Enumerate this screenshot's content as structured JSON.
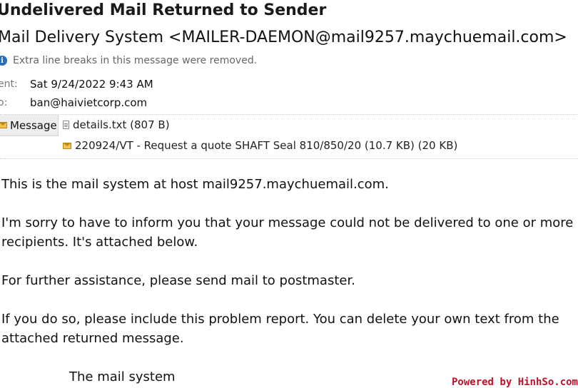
{
  "header": {
    "subject": "Undelivered Mail Returned to Sender",
    "from": "Mail Delivery System <MAILER-DAEMON@mail9257.maychuemail.com>",
    "info_notice": "Extra line breaks in this message were removed.",
    "sent_label": "ent:",
    "sent_value": "Sat 9/24/2022 9:43 AM",
    "to_label": "o:",
    "to_value": "ban@haivietcorp.com"
  },
  "attachments": {
    "message_tab": "Message",
    "items": [
      {
        "name": "details.txt (807 B)",
        "icon": "text-file-icon"
      },
      {
        "name": "220924/VT - Request a quote SHAFT Seal 810/850/20 (10.7 KB) (20 KB)",
        "icon": "envelope-icon"
      }
    ]
  },
  "body": {
    "p1": "This is the mail system at host mail9257.maychuemail.com.",
    "p2_line1": "I'm sorry to have to inform you that your message could not be delivered to one or more",
    "p2_line2": "recipients. It's attached below.",
    "p3": "For further assistance, please send mail to postmaster.",
    "p4_line1": "If you do so, please include this problem report. You can delete your own text from the",
    "p4_line2": "attached returned message.",
    "signature": "The mail system"
  },
  "watermark": "Powered by HinhSo.com"
}
